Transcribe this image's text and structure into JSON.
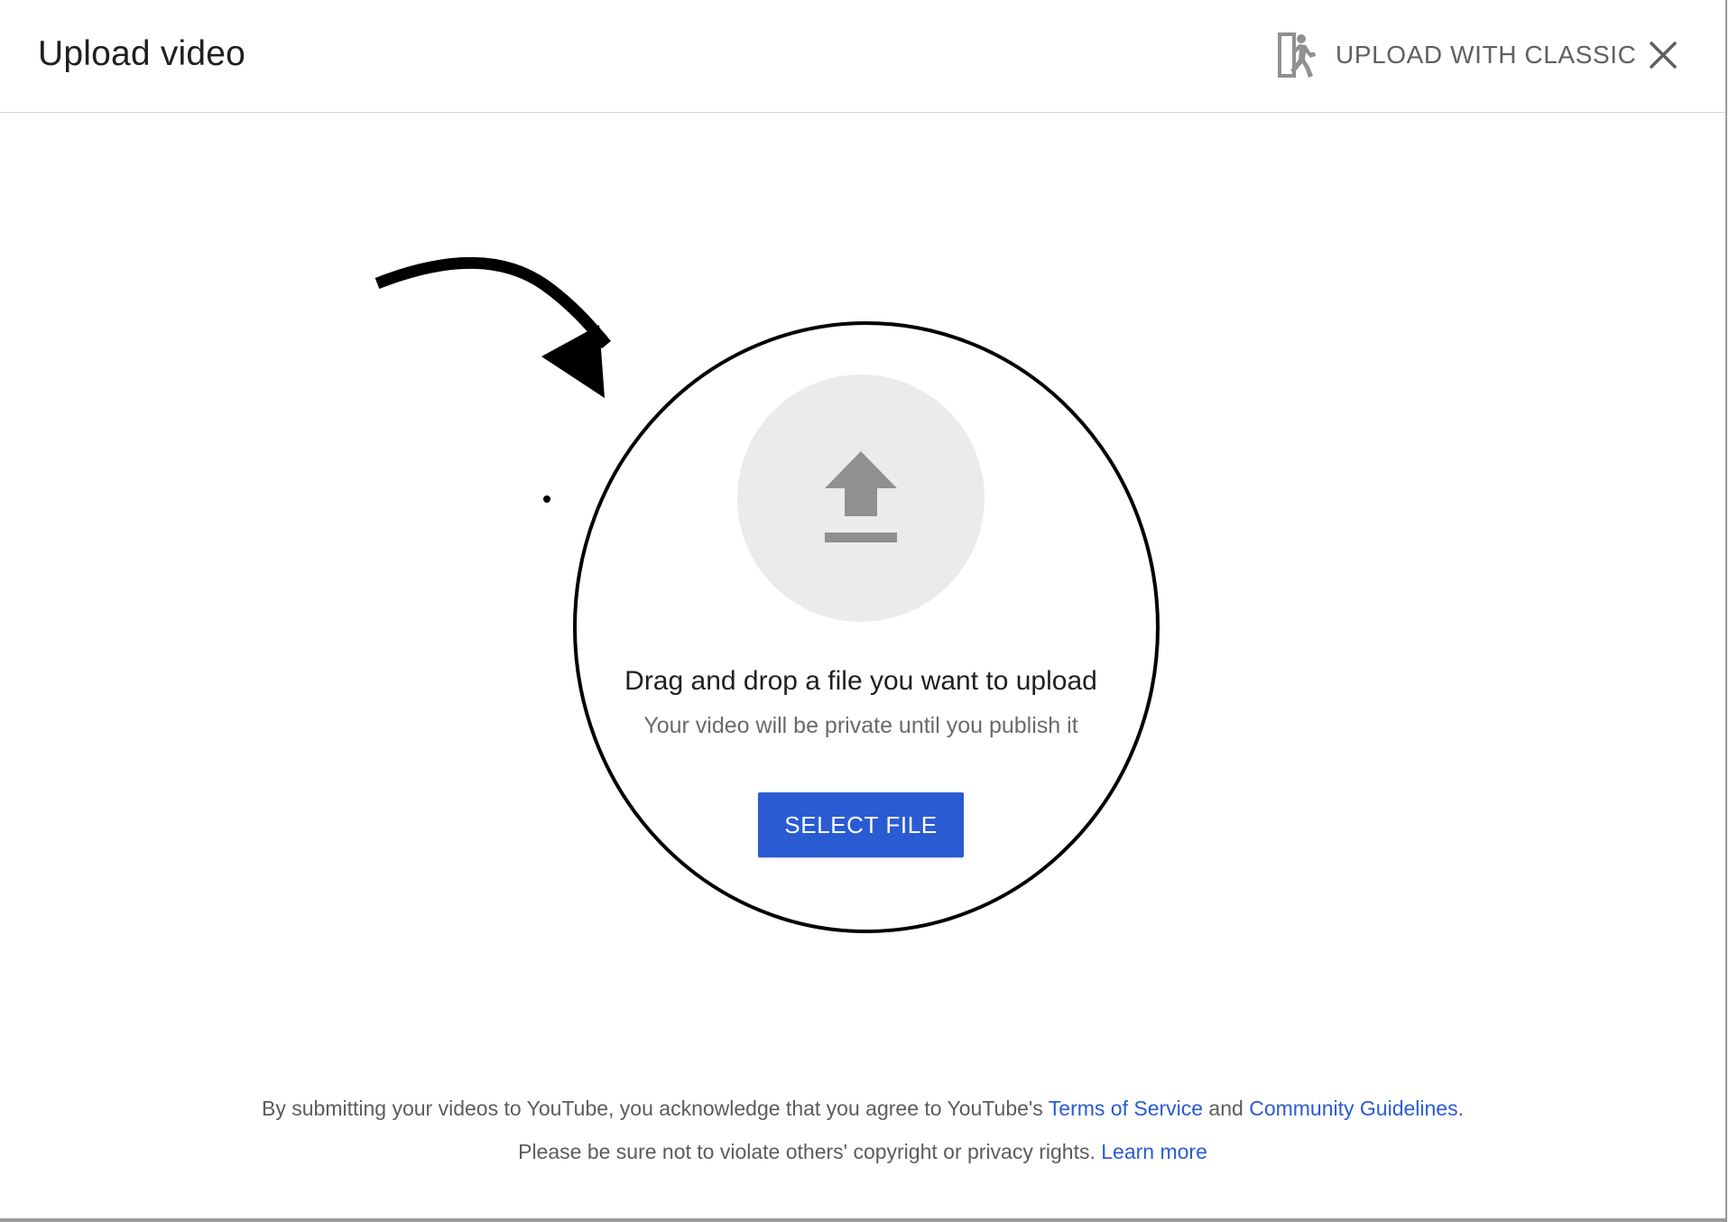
{
  "dialog": {
    "title": "Upload video",
    "classic_label": "UPLOAD WITH CLASSIC",
    "classic_icon": "exit-running-person-icon",
    "close_icon": "close-icon"
  },
  "main": {
    "upload_icon": "upload-arrow-icon",
    "drag_text": "Drag and drop a file you want to upload",
    "private_text": "Your video will be private until you publish it",
    "select_file_label": "SELECT FILE"
  },
  "footer": {
    "line1_prefix": "By submitting your videos to YouTube, you acknowledge that you agree to YouTube's ",
    "terms_link": "Terms of Service",
    "line1_and": " and ",
    "guidelines_link": "Community Guidelines",
    "line1_suffix": ".",
    "line2_prefix": "Please be sure not to violate others' copyright or privacy rights. ",
    "learn_more_link": "Learn more"
  },
  "annotation": {
    "type": "hand-drawn arrow and circle highlighting the drop zone",
    "color": "#000000"
  },
  "colors": {
    "accent": "#2a5bd3",
    "icon_gray": "#909090",
    "circle_bg": "#ebebeb"
  }
}
